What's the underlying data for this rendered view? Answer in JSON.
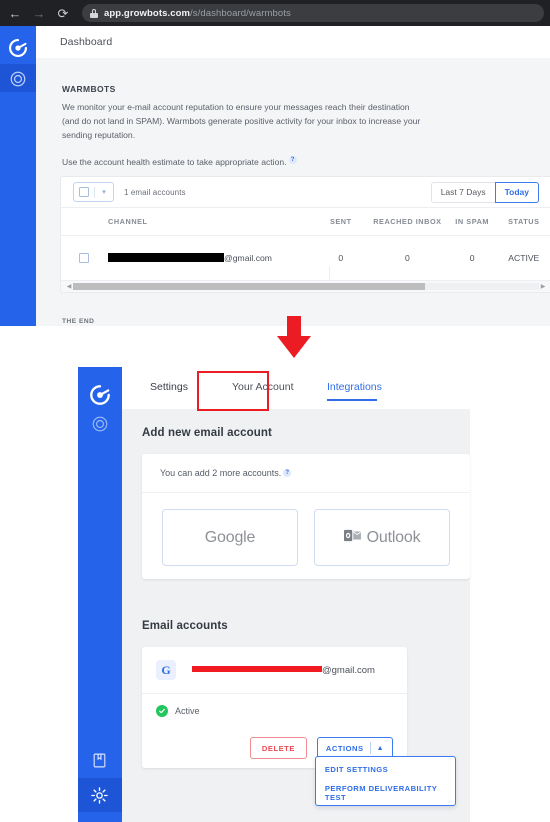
{
  "browser": {
    "back_icon": "back-arrow-icon",
    "forward_icon": "forward-arrow-icon",
    "reload_icon": "reload-icon",
    "lock_icon": "lock-icon",
    "url_host": "app.growbots.com",
    "url_path": "/s/dashboard/warmbots"
  },
  "top_app": {
    "sidebar": {
      "logo": "growbots-logo-icon",
      "items": [
        {
          "icon": "target-circle-icon",
          "active": true
        }
      ]
    },
    "topbar": {
      "title": "Dashboard"
    },
    "warmbots": {
      "heading": "WARMBOTS",
      "paragraph": "We monitor your e-mail account reputation to ensure your messages reach their destination (and do not land in SPAM). Warmbots generate positive activity for your inbox to increase your sending reputation.",
      "paragraph2": "Use the account health estimate to take appropriate action.",
      "help_icon": "question-mark-icon"
    },
    "table": {
      "select_all_checkbox": "checkbox-icon",
      "select_all_caret": "chevron-down-icon",
      "count_label": "1 email accounts",
      "range_last7": "Last 7 Days",
      "range_today": "Today",
      "columns": [
        "CHANNEL",
        "SENT",
        "REACHED INBOX",
        "IN SPAM",
        "STATUS"
      ],
      "rows": [
        {
          "channel_redacted": true,
          "channel_suffix": "@gmail.com",
          "sent": "0",
          "reached_inbox": "0",
          "in_spam": "0",
          "status": "ACTIVE"
        }
      ],
      "scroll_left_icon": "triangle-left-icon",
      "scroll_right_icon": "triangle-right-icon"
    },
    "the_end": "THE END"
  },
  "annotation": {
    "arrow_icon": "down-arrow-annotation",
    "arrow_color": "#ec1c24",
    "highlight_color": "#ec1c24"
  },
  "bottom_app": {
    "sidebar": {
      "logo": "growbots-logo-icon",
      "items": [
        {
          "icon": "target-circle-icon"
        },
        {
          "icon": "book-icon"
        },
        {
          "icon": "gear-icon",
          "active": true
        }
      ]
    },
    "tabs": [
      {
        "label": "Settings",
        "active": false
      },
      {
        "label": "Your Account",
        "active": false
      },
      {
        "label": "Integrations",
        "active": true
      }
    ],
    "add_section": {
      "title": "Add new email account",
      "note": "You can add 2 more accounts.",
      "help_icon": "question-mark-icon",
      "providers": [
        {
          "label": "Google",
          "icon": "google-icon"
        },
        {
          "label": "Outlook",
          "icon": "outlook-icon"
        }
      ]
    },
    "accounts_section": {
      "title": "Email accounts",
      "account": {
        "provider_badge": "G",
        "email_redacted": true,
        "email_suffix": "@gmail.com",
        "status": "Active",
        "status_icon": "check-circle-icon",
        "delete_label": "DELETE",
        "actions_label": "ACTIONS",
        "actions_caret_icon": "chevron-up-icon",
        "menu_items": [
          "EDIT SETTINGS",
          "PERFORM DELIVERABILITY TEST"
        ]
      }
    }
  }
}
